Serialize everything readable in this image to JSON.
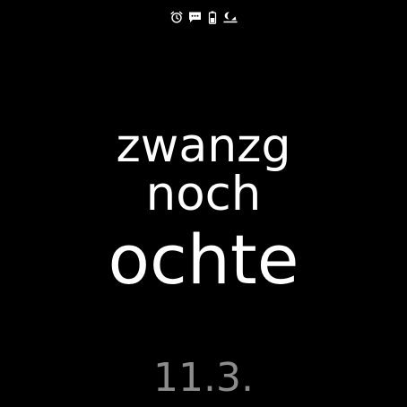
{
  "status_bar": {
    "icons": [
      "alarm-clock-icon",
      "message-icon",
      "battery-icon",
      "sleep-mode-icon"
    ],
    "icon_color": "#ffffff"
  },
  "watchface": {
    "time_words": [
      "zwanzg",
      "noch",
      "ochte"
    ],
    "date": "11.3.",
    "text_color": "#ffffff",
    "date_color": "#8c8c8c",
    "background": "#000000"
  }
}
